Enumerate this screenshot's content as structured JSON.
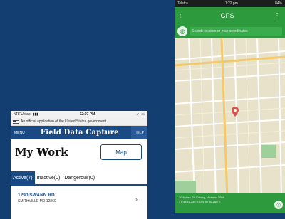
{
  "left_app": {
    "status": {
      "carrier": "NRFUMap",
      "time": "12:07 PM",
      "signal_icon": "signal-icon",
      "wifi_icon": "wifi-icon",
      "battery_icon": "battery-icon"
    },
    "gov_banner": "An official application of the United States government",
    "header": {
      "menu": "MENU",
      "title": "Field Data Capture",
      "help": "HELP"
    },
    "page_title": "My Work",
    "map_button": "Map",
    "tabs": [
      {
        "label": "Active(7)",
        "active": true
      },
      {
        "label": "Inactive(0)",
        "active": false
      },
      {
        "label": "Dangerous(0)",
        "active": false
      }
    ],
    "items": [
      {
        "address": "1290 SWANN RD",
        "city": "SMITHVILLE MD 12860"
      }
    ]
  },
  "right_app": {
    "status": {
      "carrier": "Telstra",
      "time": "1:22 pm",
      "battery": "84%"
    },
    "title": "GPS",
    "search_placeholder": "Search location or map coordinates",
    "footer_address": "10 Moore St, Coburg, Victoria, 3058",
    "footer_coords": "37°45'15.235\"S 144°57'56.280\"E",
    "colors": {
      "header_green": "#2d9a3e",
      "map_bg": "#e7e2c9",
      "pin": "#d9534f"
    }
  }
}
